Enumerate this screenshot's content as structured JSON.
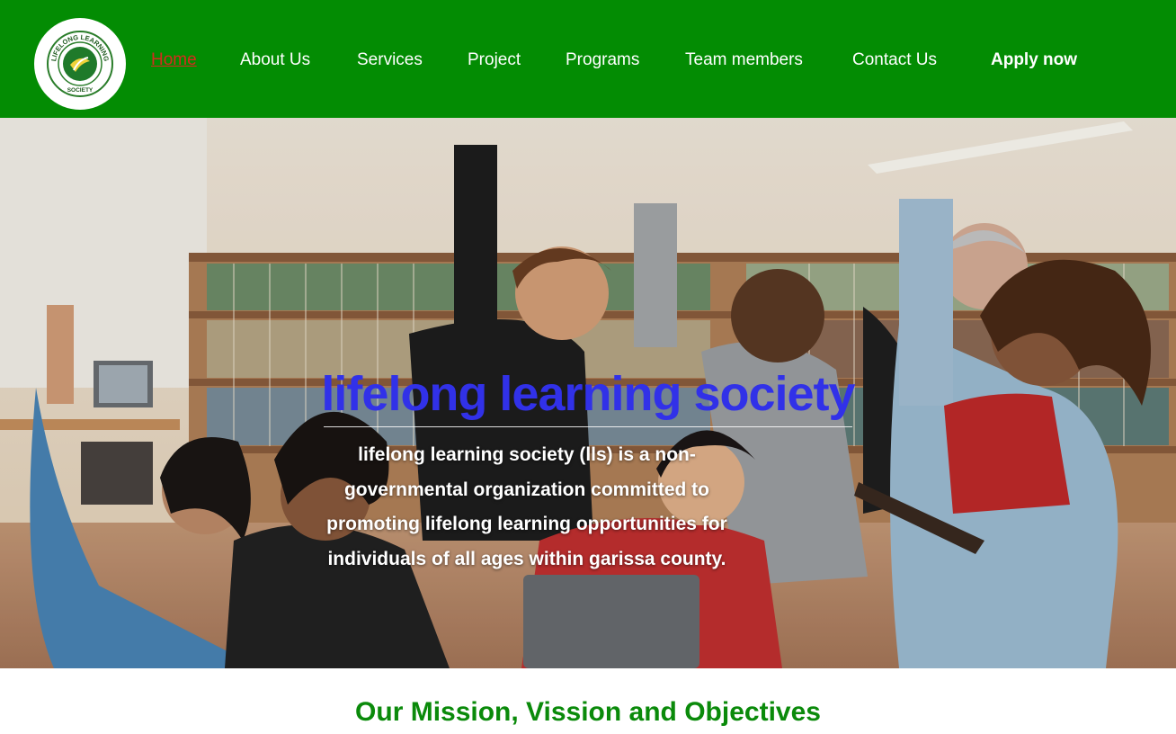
{
  "header": {
    "logo_ring_text": "LIFELONG LEARNING",
    "logo_bottom_text": "SOCIETY",
    "nav": [
      {
        "label": "Home",
        "active": true
      },
      {
        "label": "About Us"
      },
      {
        "label": "Services"
      },
      {
        "label": "Project"
      },
      {
        "label": "Programs"
      },
      {
        "label": "Team members"
      },
      {
        "label": "Contact Us"
      }
    ],
    "cta_label": "Apply now"
  },
  "hero": {
    "title": "lifelong learning society",
    "description": "lifelong learning society (lls) is a non-governmental organization committed to promoting lifelong learning opportunities for individuals of all ages within garissa county."
  },
  "mission": {
    "heading": "Our Mission, Vission and Objectives"
  },
  "colors": {
    "nav_bg": "#038c03",
    "title_blue": "#3131e8",
    "active_link": "#d62a1e",
    "heading_green": "#0a8a0a"
  }
}
